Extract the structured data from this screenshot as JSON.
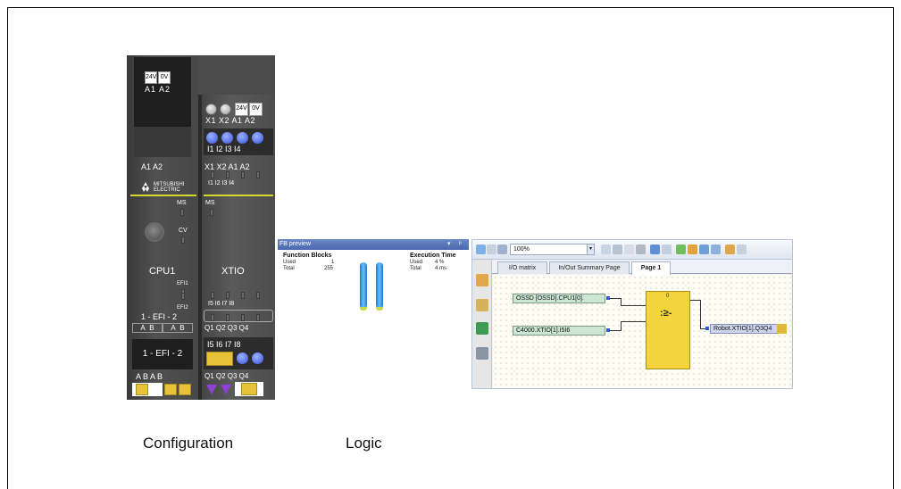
{
  "captions": {
    "configuration": "Configuration",
    "logic": "Logic"
  },
  "module": {
    "brand": "MITSUBISHI ELECTRIC",
    "cpu": {
      "top_terminals": [
        "24V",
        "0V"
      ],
      "top_labels": "A1 A2",
      "front_labels": "A1   A2",
      "led_ms": "MS",
      "led_cv": "CV",
      "name": "CPU1",
      "efi1": "EFI1",
      "efi2": "EFI2",
      "efi_label": "1 - EFI - 2",
      "ab_labels": [
        "A",
        "B",
        "A",
        "B"
      ],
      "efi_box": "1 - EFI - 2",
      "bottom_labels": "A  B  A  B"
    },
    "xtio": {
      "top_terminals": [
        "24V",
        "0V"
      ],
      "top_labels": "X1 X2 A1 A2",
      "input_labels_top": "I1  I2  I3  I4",
      "front_labels": "X1  X2  A1  A2",
      "front_inputs": "I1   I2   I3   I4",
      "led_ms": "MS",
      "name": "XTIO",
      "inputs_low": "I5   I6   I7   I8",
      "outputs": "Q1  Q2  Q3  Q4",
      "bottom_inputs": "I5  I6  I7  I8",
      "bottom_outputs": "Q1 Q2 Q3 Q4"
    }
  },
  "fb_preview": {
    "title": "FB preview",
    "function_blocks": {
      "heading": "Function Blocks",
      "used_label": "Used",
      "used_value": "1",
      "total_label": "Total",
      "total_value": "255"
    },
    "execution_time": {
      "heading": "Execution Time",
      "used_label": "Used",
      "used_value": "4 %",
      "total_label": "Total",
      "total_value": "4 ms"
    }
  },
  "editor": {
    "zoom": "100%",
    "tabs": [
      {
        "label": "I/O matrix",
        "active": false
      },
      {
        "label": "In/Out Summary Page",
        "active": false
      },
      {
        "label": "Page 1",
        "active": true
      }
    ],
    "nodes": {
      "input1": "OSSD  [OSSD].CPU1[0].",
      "input2": "C4000.XTIO[1].I5I6",
      "output1": "Robot.XTIO[1].Q3Q4"
    },
    "block_number": "0",
    "block_symbol": ":≥-"
  },
  "colors": {
    "module_body": "#4b4b4b",
    "block_yellow": "#f3d43a",
    "input_node": "#cbe6d3",
    "output_node": "#cfd5ee",
    "title_bar": "#4a68ae"
  }
}
